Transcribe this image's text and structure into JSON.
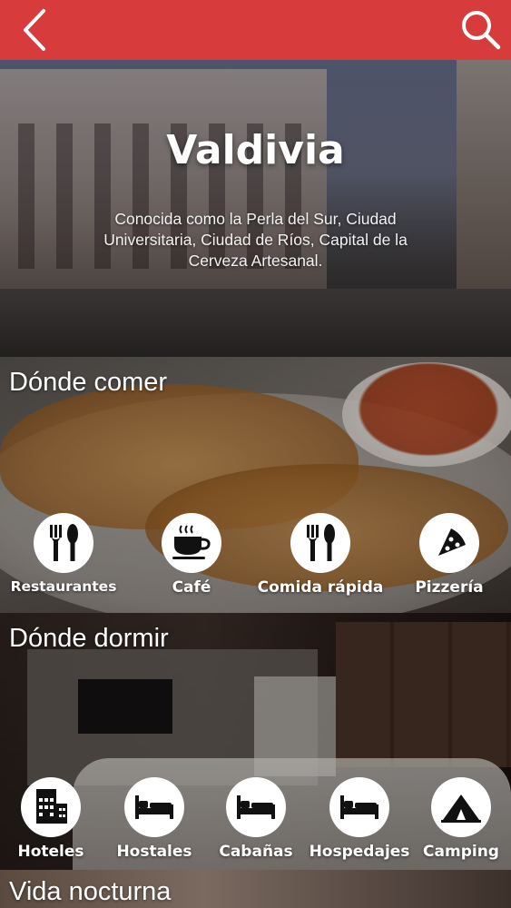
{
  "header": {
    "back_icon": "chevron-left-icon",
    "search_icon": "search-icon",
    "color": "#d83b3b"
  },
  "hero": {
    "title": "Valdivia",
    "description": "Conocida como la Perla del Sur, Ciudad Universitaria, Ciudad de Ríos, Capital de la Cerveza Artesanal."
  },
  "sections": {
    "eat": {
      "title": "Dónde comer",
      "items": [
        {
          "label": "Restaurantes",
          "icon": "fork-knife-icon"
        },
        {
          "label": "Café",
          "icon": "coffee-cup-icon"
        },
        {
          "label": "Comida rápida",
          "icon": "fork-knife-icon"
        },
        {
          "label": "Pizzería",
          "icon": "pizza-icon"
        }
      ]
    },
    "sleep": {
      "title": "Dónde dormir",
      "items": [
        {
          "label": "Hoteles",
          "icon": "hotel-icon"
        },
        {
          "label": "Hostales",
          "icon": "bed-icon"
        },
        {
          "label": "Cabañas",
          "icon": "bed-icon"
        },
        {
          "label": "Hospedajes",
          "icon": "bed-icon"
        },
        {
          "label": "Camping",
          "icon": "tent-icon"
        }
      ]
    },
    "night": {
      "title": "Vida nocturna"
    }
  }
}
